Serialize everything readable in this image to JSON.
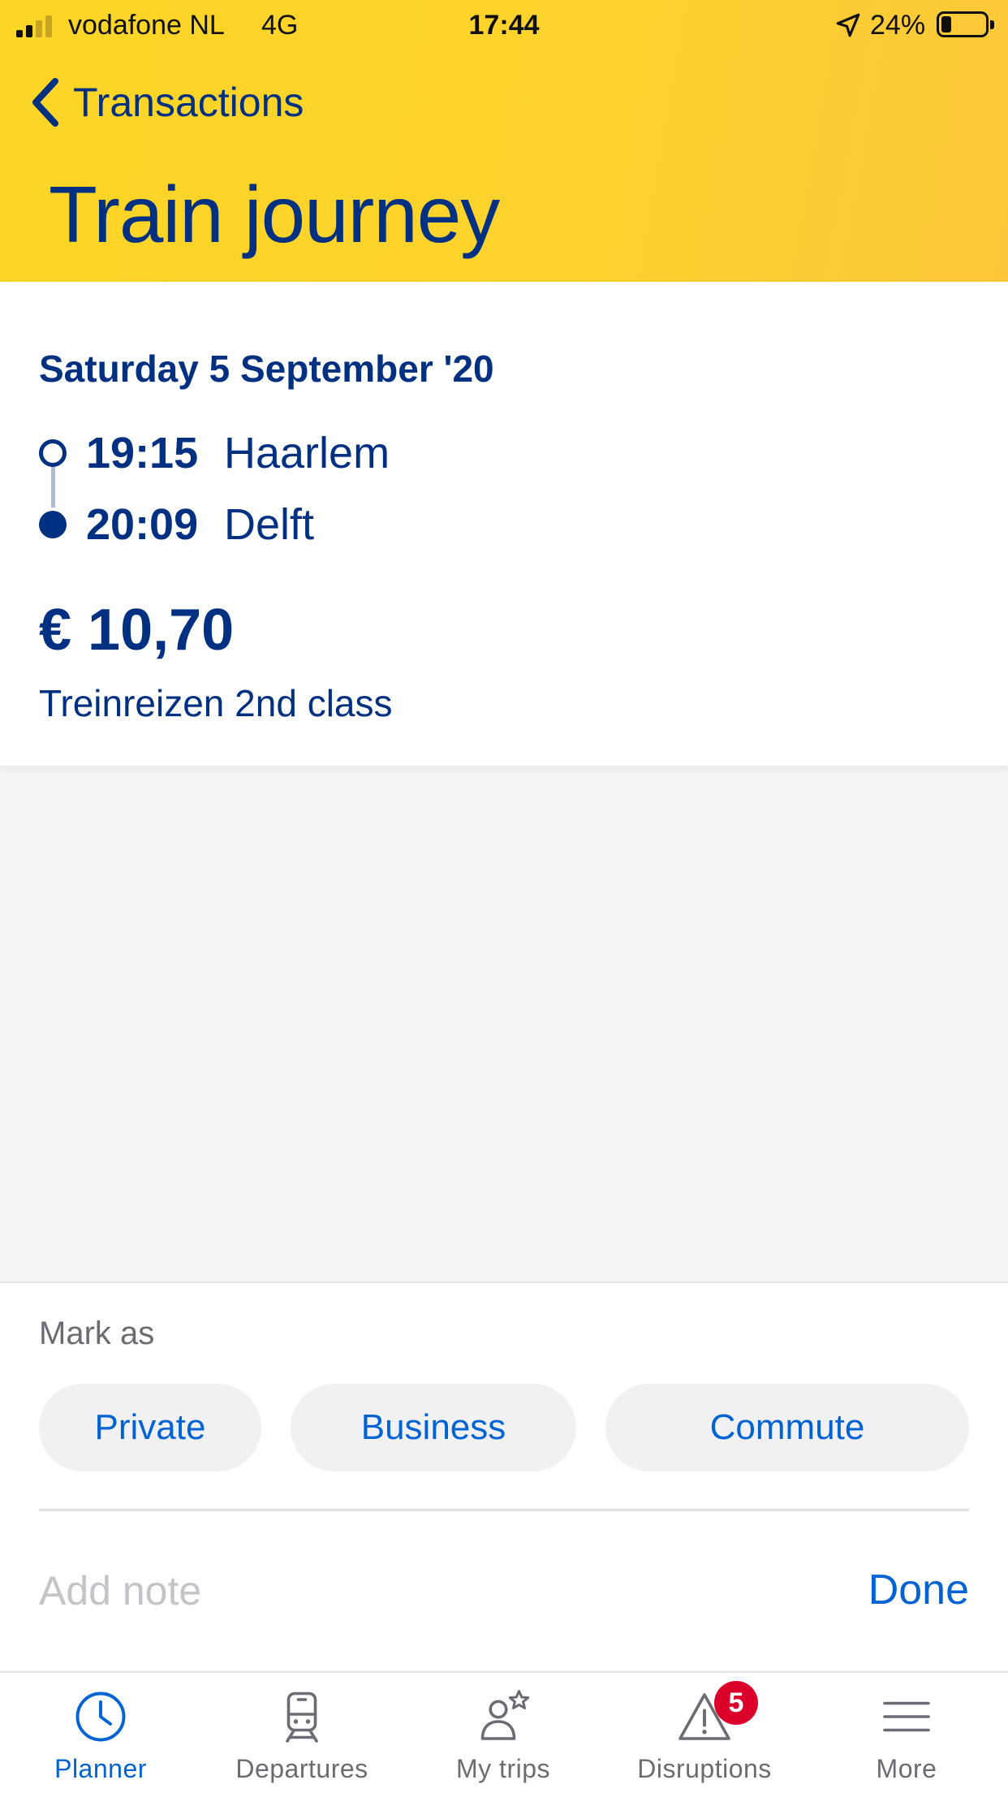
{
  "status_bar": {
    "carrier": "vodafone NL",
    "network": "4G",
    "time": "17:44",
    "battery": "24%",
    "battery_level": 0.24
  },
  "nav": {
    "back_label": "Transactions",
    "title": "Train journey"
  },
  "journey": {
    "date": "Saturday 5 September '20",
    "departure": {
      "time": "19:15",
      "station": "Haarlem"
    },
    "arrival": {
      "time": "20:09",
      "station": "Delft"
    },
    "price": "€ 10,70",
    "ticket_type": "Treinreizen 2nd class"
  },
  "sheet": {
    "mark_as_label": "Mark as",
    "options": [
      "Private",
      "Business",
      "Commute"
    ],
    "note_placeholder": "Add note",
    "done_label": "Done"
  },
  "tab_bar": {
    "tabs": [
      {
        "label": "Planner",
        "icon": "clock-icon",
        "active": true
      },
      {
        "label": "Departures",
        "icon": "train-icon",
        "active": false
      },
      {
        "label": "My trips",
        "icon": "person-star-icon",
        "active": false
      },
      {
        "label": "Disruptions",
        "icon": "warning-icon",
        "active": false,
        "badge": "5"
      },
      {
        "label": "More",
        "icon": "menu-icon",
        "active": false
      }
    ]
  },
  "colors": {
    "header_yellow": "#FCD625",
    "brand_blue": "#003082",
    "link_blue": "#0063D3",
    "badge_red": "#DB0029"
  }
}
